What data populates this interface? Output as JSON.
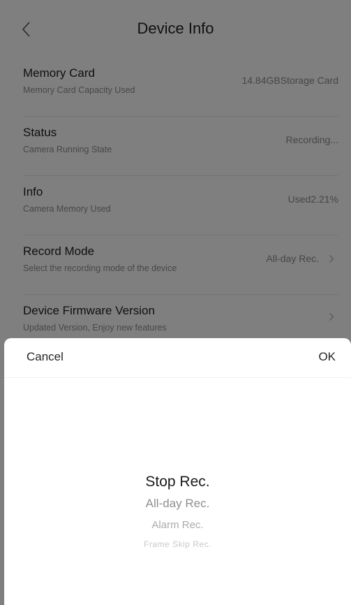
{
  "header": {
    "title": "Device Info",
    "back_icon": "chevron-left-icon"
  },
  "settings": [
    {
      "title": "Memory Card",
      "subtitle": "Memory Card Capacity Used",
      "value": "14.84GBStorage Card",
      "chevron": false
    },
    {
      "title": "Status",
      "subtitle": "Camera Running State",
      "value": "Recording...",
      "chevron": false
    },
    {
      "title": "Info",
      "subtitle": "Camera Memory Used",
      "value": "Used2.21%",
      "chevron": false
    },
    {
      "title": "Record Mode",
      "subtitle": "Select the recording mode of the device",
      "value": "All-day Rec.",
      "chevron": true
    },
    {
      "title": "Device Firmware Version",
      "subtitle": "Updated Version, Enjoy new features",
      "value": "",
      "chevron": true
    }
  ],
  "picker": {
    "cancel_label": "Cancel",
    "ok_label": "OK",
    "selected": "Stop Rec.",
    "options": [
      "Stop Rec.",
      "All-day Rec.",
      "Alarm Rec.",
      "Frame Skip Rec."
    ]
  },
  "colors": {
    "overlay": "rgba(0,0,0,0.5)",
    "text_primary": "#1e1e1e",
    "text_secondary": "#8e8e8e"
  }
}
